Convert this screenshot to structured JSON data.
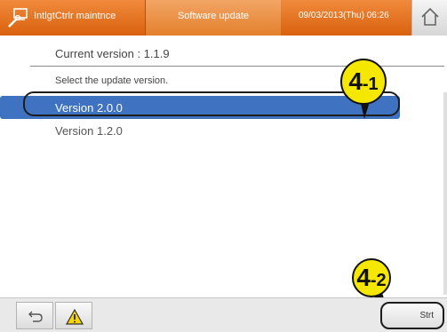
{
  "header": {
    "app_title": "IntlgtCtrlr maintnce",
    "screen_title": "Software update",
    "datetime": "09/03/2013(Thu) 06:26"
  },
  "main": {
    "current_version": "Current version : 1.1.9",
    "select_label": "Select the update version.",
    "versions": [
      {
        "label": "Version 2.0.0",
        "selected": true
      },
      {
        "label": "Version 1.2.0",
        "selected": false
      }
    ]
  },
  "callouts": {
    "c1_big": "4",
    "c1_small": "-1",
    "c2_big": "4",
    "c2_small": "-2"
  },
  "footer": {
    "start_label": "Strt"
  },
  "colors": {
    "header_orange": "#e2802c",
    "selection_blue": "#3f73c2",
    "callout_yellow": "#f5e700"
  }
}
